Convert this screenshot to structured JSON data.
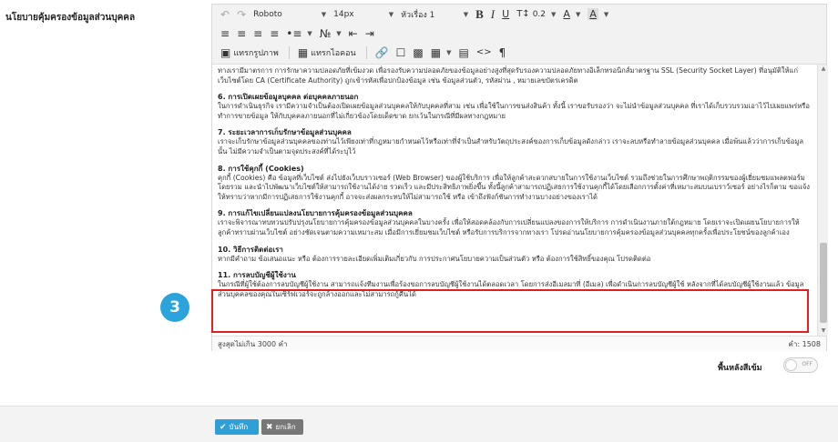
{
  "form": {
    "field_label": "นโยบายคุ้มครองข้อมูลส่วนบุคคล"
  },
  "toolbar": {
    "undo_icon": "undo-icon",
    "redo_icon": "redo-icon",
    "font_family": "Roboto",
    "font_size": "14px",
    "paragraph_style": "หัวเรื่อง 1",
    "bold": "B",
    "italic": "I",
    "underline": "U",
    "line_height": "0.2",
    "text_color": "A",
    "bg_color": "A",
    "insert_image": "แทรกรูปภาพ",
    "insert_icon": "แทรกไอคอน"
  },
  "content": {
    "intro": "ทางเรามีมาตรการ การรักษาความปลอดภัยที่เข้มงวด เพื่อรองรับความปลอดภัยของข้อมูลอย่างสูงที่สุดรับรองความปลอดภัยทางอิเล็กทรอนิกส์มาตรฐาน SSL (Security Socket Layer) ที่อนุมัติให้แก่เว็บไซต์โดย CA (Certificate Authority) ถูกเข้ารหัสเพื่อปกป้องข้อมูล เช่น ข้อมูลส่วนตัว, รหัสผ่าน , หมายเลขบัตรเครดิต",
    "sections": [
      {
        "title": "6. การเปิดเผยข้อมูลบุคคล ต่อบุคคลภายนอก",
        "body": "ในการดำเนินธุรกิจ เรามีความจำเป็นต้องเปิดเผยข้อมูลส่วนบุคคลให้กับบุคคลที่สาม เช่น เพื่อใช้ในการขนส่งสินค้า ทั้งนี้ เราขอรับรองว่า จะไม่นำข้อมูลส่วนบุคคล ที่เราได้เก็บรวบรวมเอาไว้ไปเผยแพร่หรือทำการขายข้อมูล ให้กับบุคคลภายนอกที่ไม่เกี่ยวข้องโดยเด็ดขาด ยกเว้นในกรณีที่มีผลทางกฎหมาย"
      },
      {
        "title": "7. ระยะเวลาการเก็บรักษาข้อมูลส่วนบุคคล",
        "body": "เราจะเก็บรักษาข้อมูลส่วนบุคคลของท่านไว้เพียงเท่าที่กฎหมายกำหนดไว้หรือเท่าที่จำเป็นสำหรับวัตถุประสงค์ของการเก็บข้อมูลดังกล่าว เราจะลบหรือทำลายข้อมูลส่วนบุคคล เมื่อพ้นแล้วว่าการเก็บข้อมูลนั้น ไม่มีความจำเป็นตามจุดประสงค์ที่ได้ระบุไว้"
      },
      {
        "title": "8. การใช้คุกกี้ (Cookies)",
        "body": "คุกกี้ (Cookies) คือ ข้อมูลที่เว็บไซต์ ส่งไปยังเว็บบราวเซอร์ (Web Browser) ของผู้ใช้บริการ เพื่อให้ลูกค้าสะดวกสบายในการใช้งานเว็บไซต์ รวมถึงช่วยในการศึกษาพฤติกรรมของผู้เยี่ยมชมแพลตฟอร์มโดยรวม และนำไปพัฒนาเว็บไซต์ให้สามารถใช้งานได้ง่าย รวดเร็ว และมีประสิทธิภาพยิ่งขึ้น ทั้งนี้ลูกค้าสามารถปฏิเสธการใช้งานคุกกี้ได้โดยเลือกการตั้งค่าที่เหมาะสมบนเบราว์เซอร์ อย่างไรก็ตาม ขอแจ้งให้ทราบว่าหากมีการปฏิเสธการใช้งานคุกกี้ อาจจะส่งผลกระทบให้ไม่สามารถใช้ หรือ เข้าถึงฟังก์ชันการทำงานบางอย่างของเราได้"
      },
      {
        "title": "9. การแก้ไขเปลี่ยนแปลงนโยบายการคุ้มครองข้อมูลส่วนบุคคล",
        "body": "เราจะพิจารณาทบทวนปรับปรุงนโยบายการคุ้มครองข้อมูลส่วนบุคคลในบางครั้ง เพื่อให้สอดคล้องกับการเปลี่ยนแปลงของการให้บริการ การดำเนินงานภายใต้กฎหมาย โดยเราจะเปิดเผยนโยบายการให้ลูกค้าทราบผ่านเว็บไซต์ อย่างชัดเจนตามความเหมาะสม เมื่อมีการเยี่ยมชมเว็บไซต์ หรือรับการบริการจากทางเรา โปรดอ่านนโยบายการคุ้มครองข้อมูลส่วนบุคคลทุกครั้งเพื่อประโยชน์ของลูกค้าเอง"
      },
      {
        "title": "10. วิธีการติดต่อเรา",
        "body": "หากมีคำถาม ข้อเสนอแนะ หรือ ต้องการรายละเอียดเพิ่มเติมเกี่ยวกับ การประกาศนโยบายความเป็นส่วนตัว หรือ ต้องการใช้สิทธิ์ของคุณ โปรดติดต่อ"
      },
      {
        "title": "11. การลบบัญชีผู้ใช้งาน",
        "body": "ในกรณีที่ผู้ใช้ต้องการลบบัญชีผู้ใช้งาน สามารถแจ้งทีมงานเพื่อร้องขอการลบบัญชีผู้ใช้งานได้ตลอดเวลา โดยการส่งอีเมลมาที่ (อีเมล) เพื่อดำเนินการลบบัญชีผู้ใช้ หลังจากที่ได้ลบบัญชีผู้ใช้งานแล้ว ข้อมูลส่วนบุคคลของคุณในเซิร์ฟเวอร์จะถูกล้างออกและไม่สามารถกู้คืนได้"
      }
    ]
  },
  "footer": {
    "limit_text": "สูงสุดไม่เกิน 3000 คำ",
    "word_count": "คำ: 1508"
  },
  "step_badge": "3",
  "background_toggle": {
    "label": "พื้นหลังสีเข้ม",
    "state": "OFF"
  },
  "actions": {
    "save_label": "บันทึก",
    "cancel_label": "ยกเลิก"
  },
  "colors": {
    "accent": "#2f9fd8",
    "badge": "#2ba4dd",
    "highlight_border": "#e02020",
    "cancel_button": "#777777"
  }
}
